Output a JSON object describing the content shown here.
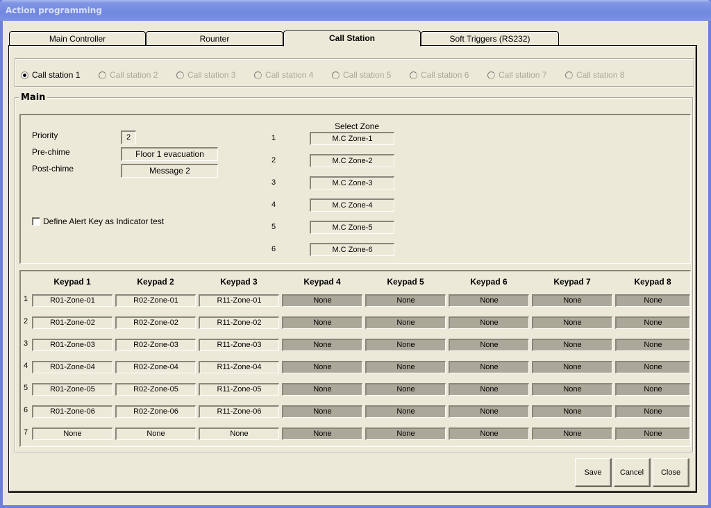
{
  "window": {
    "title": "Action programming"
  },
  "tabs": [
    {
      "label": "Main Controller",
      "active": false
    },
    {
      "label": "Rounter",
      "active": false
    },
    {
      "label": "Call Station",
      "active": true
    },
    {
      "label": "Soft Triggers (RS232)",
      "active": false
    }
  ],
  "call_stations": [
    {
      "label": "Call station 1",
      "checked": true,
      "enabled": true
    },
    {
      "label": "Call station 2",
      "checked": false,
      "enabled": false
    },
    {
      "label": "Call station 3",
      "checked": false,
      "enabled": false
    },
    {
      "label": "Call station 4",
      "checked": false,
      "enabled": false
    },
    {
      "label": "Call station 5",
      "checked": false,
      "enabled": false
    },
    {
      "label": "Call station 6",
      "checked": false,
      "enabled": false
    },
    {
      "label": "Call station 7",
      "checked": false,
      "enabled": false
    },
    {
      "label": "Call station 8",
      "checked": false,
      "enabled": false
    }
  ],
  "main": {
    "legend": "Main",
    "priority_label": "Priority",
    "priority_value": "2",
    "prechime_label": "Pre-chime",
    "prechime_value": "Floor 1 evacuation",
    "postchime_label": "Post-chime",
    "postchime_value": "Message 2",
    "alert_checkbox_label": "Define Alert Key as Indicator test",
    "alert_checkbox_checked": false,
    "select_zone_header": "Select Zone",
    "zones": [
      {
        "num": "1",
        "value": "M.C Zone-1"
      },
      {
        "num": "2",
        "value": "M.C Zone-2"
      },
      {
        "num": "3",
        "value": "M.C Zone-3"
      },
      {
        "num": "4",
        "value": "M.C Zone-4"
      },
      {
        "num": "5",
        "value": "M.C Zone-5"
      },
      {
        "num": "6",
        "value": "M.C Zone-6"
      }
    ]
  },
  "keypads": {
    "headers": [
      "Keypad 1",
      "Keypad 2",
      "Keypad 3",
      "Keypad 4",
      "Keypad 5",
      "Keypad 6",
      "Keypad 7",
      "Keypad 8"
    ],
    "enabled_columns": [
      true,
      true,
      true,
      false,
      false,
      false,
      false,
      false
    ],
    "rows": [
      {
        "num": "1",
        "cells": [
          "R01-Zone-01",
          "R02-Zone-01",
          "R11-Zone-01",
          "None",
          "None",
          "None",
          "None",
          "None"
        ]
      },
      {
        "num": "2",
        "cells": [
          "R01-Zone-02",
          "R02-Zone-02",
          "R11-Zone-02",
          "None",
          "None",
          "None",
          "None",
          "None"
        ]
      },
      {
        "num": "3",
        "cells": [
          "R01-Zone-03",
          "R02-Zone-03",
          "R11-Zone-03",
          "None",
          "None",
          "None",
          "None",
          "None"
        ]
      },
      {
        "num": "4",
        "cells": [
          "R01-Zone-04",
          "R02-Zone-04",
          "R11-Zone-04",
          "None",
          "None",
          "None",
          "None",
          "None"
        ]
      },
      {
        "num": "5",
        "cells": [
          "R01-Zone-05",
          "R02-Zone-05",
          "R11-Zone-05",
          "None",
          "None",
          "None",
          "None",
          "None"
        ]
      },
      {
        "num": "6",
        "cells": [
          "R01-Zone-06",
          "R02-Zone-06",
          "R11-Zone-06",
          "None",
          "None",
          "None",
          "None",
          "None"
        ]
      },
      {
        "num": "7",
        "cells": [
          "None",
          "None",
          "None",
          "None",
          "None",
          "None",
          "None",
          "None"
        ]
      }
    ]
  },
  "buttons": {
    "save": "Save",
    "cancel": "Cancel",
    "close": "Close"
  }
}
